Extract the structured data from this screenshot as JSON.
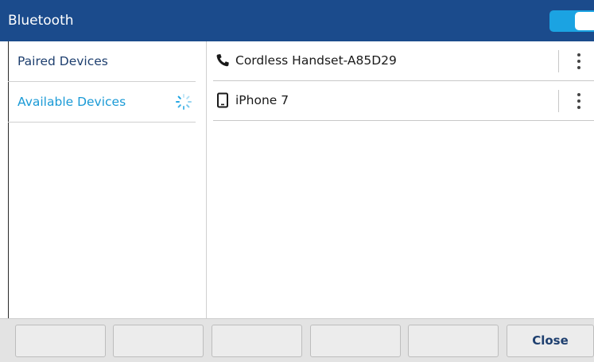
{
  "header": {
    "title": "Bluetooth",
    "toggle_on": true,
    "accent_color": "#1ba3e2",
    "header_color": "#1b4b8c"
  },
  "sidebar": {
    "items": [
      {
        "label": "Paired Devices",
        "active": false
      },
      {
        "label": "Available Devices",
        "active": true,
        "loading": true
      }
    ]
  },
  "devices": [
    {
      "name": "Cordless Handset-A85D29",
      "icon": "phone-handset-icon"
    },
    {
      "name": "iPhone 7",
      "icon": "mobile-phone-icon"
    }
  ],
  "softkeys": [
    "",
    "",
    "",
    "",
    "",
    "Close"
  ]
}
